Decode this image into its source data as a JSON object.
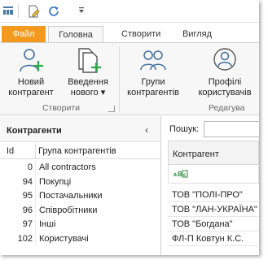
{
  "quick_access": {
    "icons": [
      "grid-menu-icon",
      "edit-page-icon",
      "refresh-icon",
      "customize-dropdown-icon"
    ]
  },
  "tabs": [
    {
      "label": "Файл"
    },
    {
      "label": "Головна"
    },
    {
      "label": "Створити"
    },
    {
      "label": "Вигляд"
    }
  ],
  "ribbon": {
    "buttons": [
      {
        "label_line1": "Новий",
        "label_line2": "контрагент"
      },
      {
        "label_line1": "Введення",
        "label_line2": "нового ▾"
      },
      {
        "label_line1": "Групи",
        "label_line2": "контрагентів"
      },
      {
        "label_line1": "Профілі",
        "label_line2": "користувачів"
      }
    ],
    "group_create": "Створити",
    "group_edit": "Редагува"
  },
  "left_pane": {
    "title": "Контрагенти",
    "collapse_glyph": "‹",
    "columns": {
      "id": "Id",
      "name": "Група контрагентів"
    },
    "rows": [
      {
        "id": "0",
        "name": "All contractors"
      },
      {
        "id": "94",
        "name": "Покупці"
      },
      {
        "id": "95",
        "name": "Постачальники"
      },
      {
        "id": "96",
        "name": "Співробітники"
      },
      {
        "id": "97",
        "name": "Інші"
      },
      {
        "id": "102",
        "name": "Користувачі"
      }
    ]
  },
  "right_pane": {
    "search_label": "Пошук:",
    "search_value": "",
    "column": "Контрагент",
    "filter_icon_text": "ᴀ|c",
    "rows": [
      "ТОВ \"ПОЛІ-ПРО\"",
      "ТОВ \"ЛАН-УКРАЇНА\"",
      "ТОВ \"Богдана\"",
      "ФЛ-П Ковтун К.С."
    ]
  },
  "colors": {
    "file_tab": "#f39a1e",
    "accent_icon": "#2ea84a",
    "icon_blue": "#3f6f9f"
  }
}
